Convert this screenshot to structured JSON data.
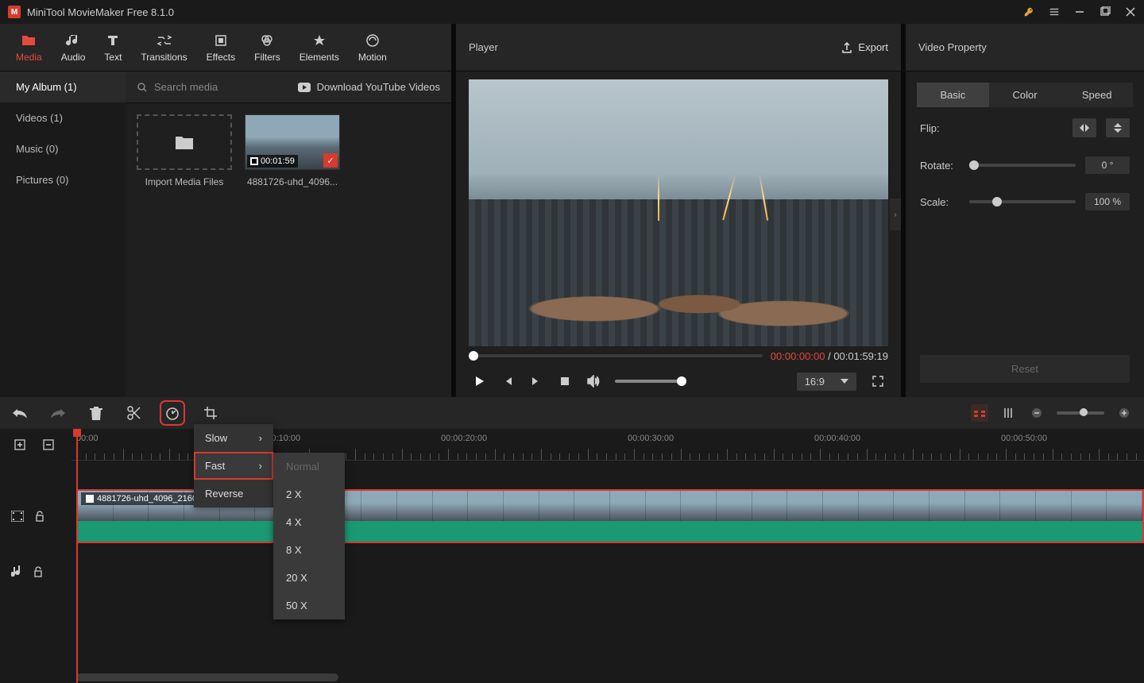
{
  "app": {
    "title": "MiniTool MovieMaker Free 8.1.0"
  },
  "tabs": [
    {
      "label": "Media",
      "icon": "folder"
    },
    {
      "label": "Audio",
      "icon": "music"
    },
    {
      "label": "Text",
      "icon": "text"
    },
    {
      "label": "Transitions",
      "icon": "transition"
    },
    {
      "label": "Effects",
      "icon": "effects"
    },
    {
      "label": "Filters",
      "icon": "filters"
    },
    {
      "label": "Elements",
      "icon": "elements"
    },
    {
      "label": "Motion",
      "icon": "motion"
    }
  ],
  "sidebar": {
    "items": [
      {
        "label": "My Album (1)"
      },
      {
        "label": "Videos (1)"
      },
      {
        "label": "Music (0)"
      },
      {
        "label": "Pictures (0)"
      }
    ]
  },
  "media": {
    "search_placeholder": "Search media",
    "download_label": "Download YouTube Videos",
    "import_label": "Import Media Files",
    "clip": {
      "duration": "00:01:59",
      "name": "4881726-uhd_4096..."
    }
  },
  "player": {
    "title": "Player",
    "export": "Export",
    "current": "00:00:00:00",
    "total": "00:01:59:19",
    "aspect": "16:9"
  },
  "props": {
    "title": "Video Property",
    "tabs": [
      "Basic",
      "Color",
      "Speed"
    ],
    "flip": "Flip:",
    "rotate": "Rotate:",
    "rotate_val": "0 °",
    "scale": "Scale:",
    "scale_val": "100 %",
    "reset": "Reset"
  },
  "timeline": {
    "ruler": [
      "00:00",
      "00:00:10:00",
      "00:00:20:00",
      "00:00:30:00",
      "00:00:40:00",
      "00:00:50:00"
    ],
    "clip_name": "4881726-uhd_4096_2160_25fps"
  },
  "speed_menu": {
    "items": [
      "Slow",
      "Fast",
      "Reverse"
    ],
    "sub": [
      "Normal",
      "2 X",
      "4 X",
      "8 X",
      "20 X",
      "50 X"
    ]
  }
}
